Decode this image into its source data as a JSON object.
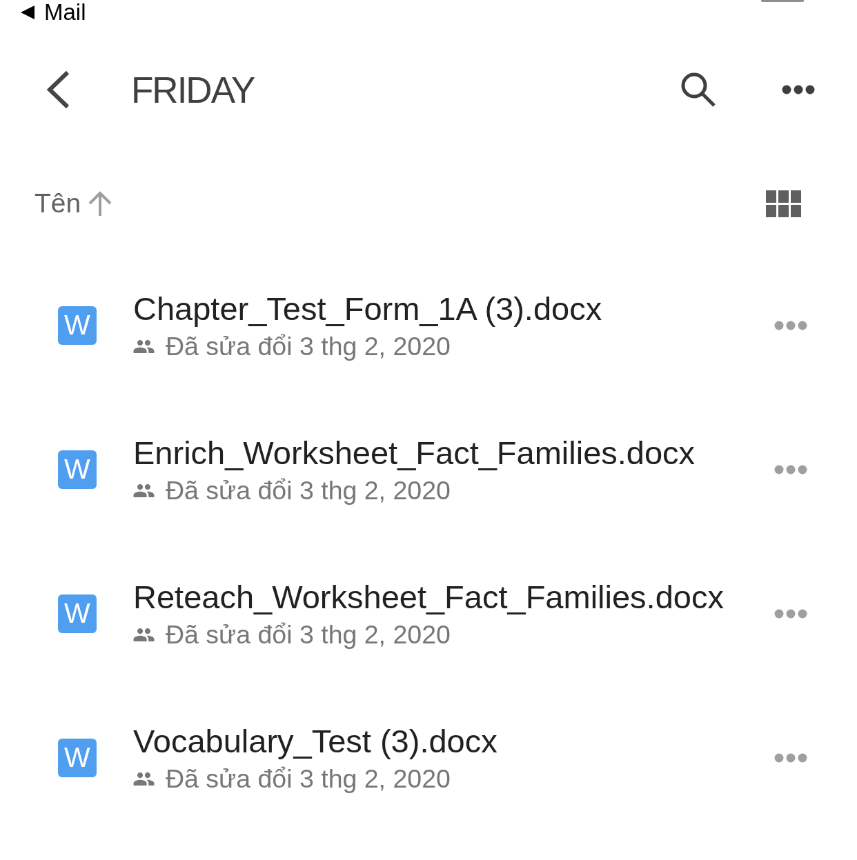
{
  "status_bar": {
    "back_app": "Mail"
  },
  "header": {
    "title": "FRIDAY"
  },
  "sort": {
    "label": "Tên",
    "ascending": true
  },
  "files": [
    {
      "name": "Chapter_Test_Form_1A (3).docx",
      "type_letter": "W",
      "shared": true,
      "modified": "Đã sửa đổi 3 thg 2, 2020"
    },
    {
      "name": "Enrich_Worksheet_Fact_Families.docx",
      "type_letter": "W",
      "shared": true,
      "modified": "Đã sửa đổi 3 thg 2, 2020"
    },
    {
      "name": "Reteach_Worksheet_Fact_Families.docx",
      "type_letter": "W",
      "shared": true,
      "modified": "Đã sửa đổi 3 thg 2, 2020"
    },
    {
      "name": "Vocabulary_Test (3).docx",
      "type_letter": "W",
      "shared": true,
      "modified": "Đã sửa đổi 3 thg 2, 2020"
    }
  ]
}
